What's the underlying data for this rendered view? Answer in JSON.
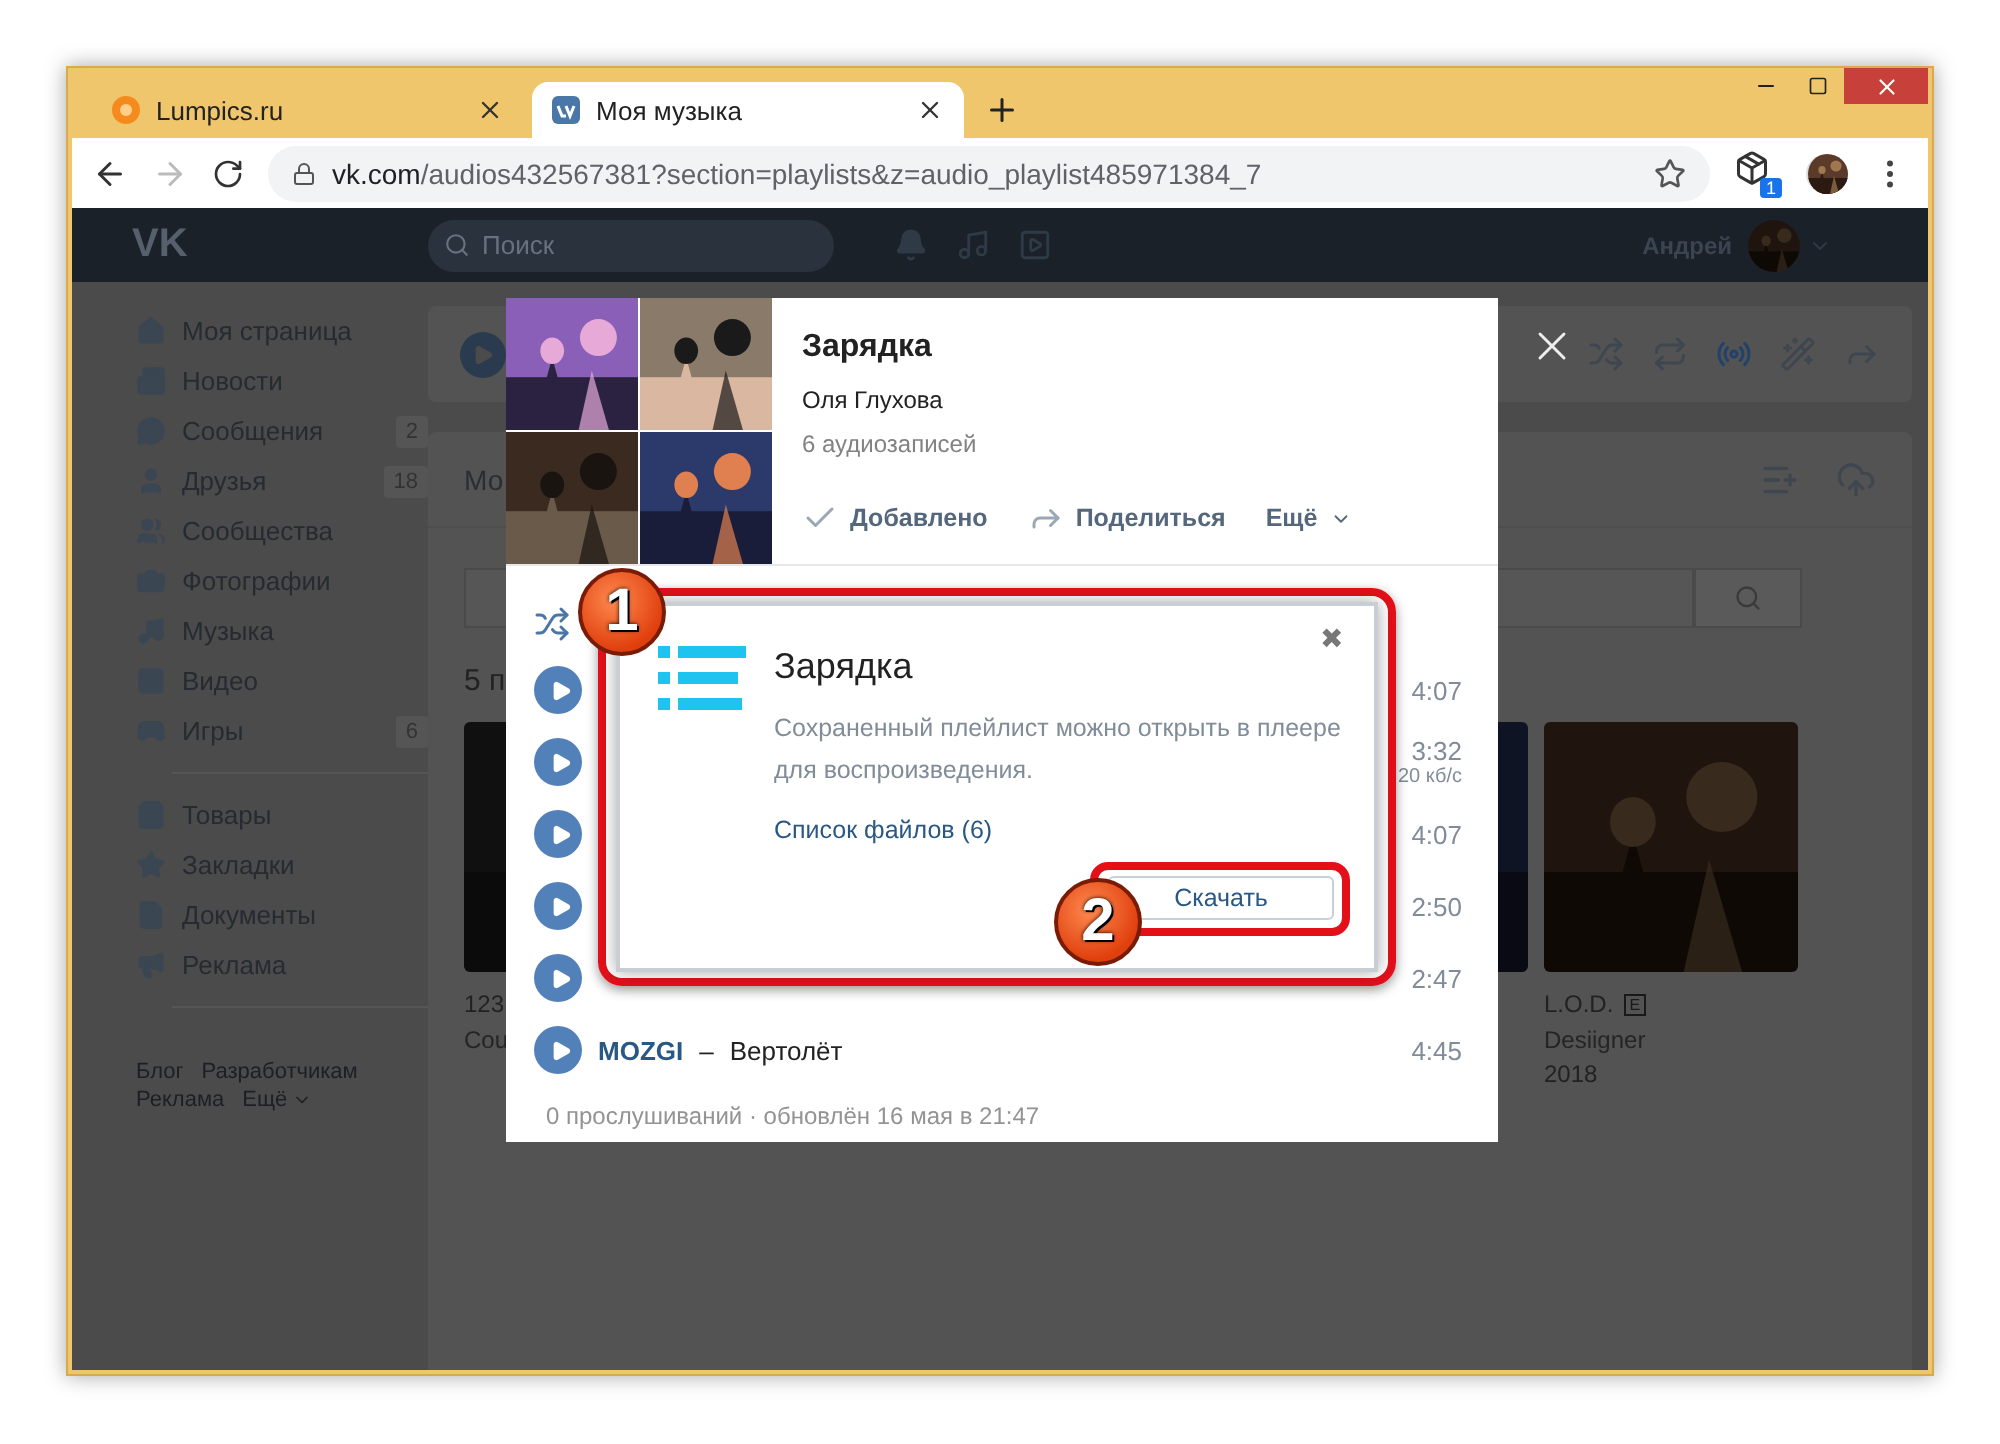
{
  "browser": {
    "tabs": [
      {
        "title": "Lumpics.ru",
        "selected": false
      },
      {
        "title": "Моя музыка",
        "selected": true
      }
    ],
    "url_host": "vk.com",
    "url_path": "/audios432567381?section=playlists&z=audio_playlist485971384_7",
    "extension_badge": "1"
  },
  "vk": {
    "logo": "VK",
    "search_placeholder": "Поиск",
    "user_name": "Андрей"
  },
  "sidebar": {
    "main": [
      {
        "label": "Моя страница"
      },
      {
        "label": "Новости"
      },
      {
        "label": "Сообщения",
        "counter": "2"
      },
      {
        "label": "Друзья",
        "counter": "18"
      },
      {
        "label": "Сообщества"
      },
      {
        "label": "Фотографии"
      },
      {
        "label": "Музыка"
      },
      {
        "label": "Видео"
      },
      {
        "label": "Игры",
        "counter": "6"
      }
    ],
    "more": [
      {
        "label": "Товары"
      },
      {
        "label": "Закладки"
      },
      {
        "label": "Документы"
      },
      {
        "label": "Реклама"
      }
    ],
    "footer": [
      "Блог",
      "Разработчикам",
      "Реклама",
      "Ещё"
    ]
  },
  "music": {
    "section_title": "Мо",
    "albums_heading": "5 п",
    "albums": [
      {
        "title": "123",
        "artist": "Cou"
      },
      {
        "title": "L.O.D.",
        "badge": "E",
        "artist": "Desiigner",
        "year": "2018"
      }
    ]
  },
  "modal": {
    "title": "Зарядка",
    "owner": "Оля Глухова",
    "count": "6 аудиозаписей",
    "actions": [
      {
        "kind": "added",
        "label": "Добавлено"
      },
      {
        "kind": "share",
        "label": "Поделиться"
      },
      {
        "kind": "more",
        "label": "Ещё"
      }
    ],
    "tracks": [
      {
        "duration": "4:07"
      },
      {
        "duration": "3:32",
        "bitrate": "20 кб/с"
      },
      {
        "duration": "4:07"
      },
      {
        "duration": "2:50"
      },
      {
        "duration": "2:47"
      },
      {
        "artist": "MOZGI",
        "dash": "–",
        "title": "Вертолёт",
        "duration": "4:45"
      }
    ],
    "footer": "0 прослушиваний · обновлён 16 мая в 21:47"
  },
  "dialog": {
    "title": "Зарядка",
    "close": "✖",
    "message": "Сохраненный плейлист можно открыть в плеере для воспроизведения.",
    "files_link": "Список файлов (6)",
    "download": "Скачать"
  },
  "callouts": [
    "1",
    "2"
  ]
}
